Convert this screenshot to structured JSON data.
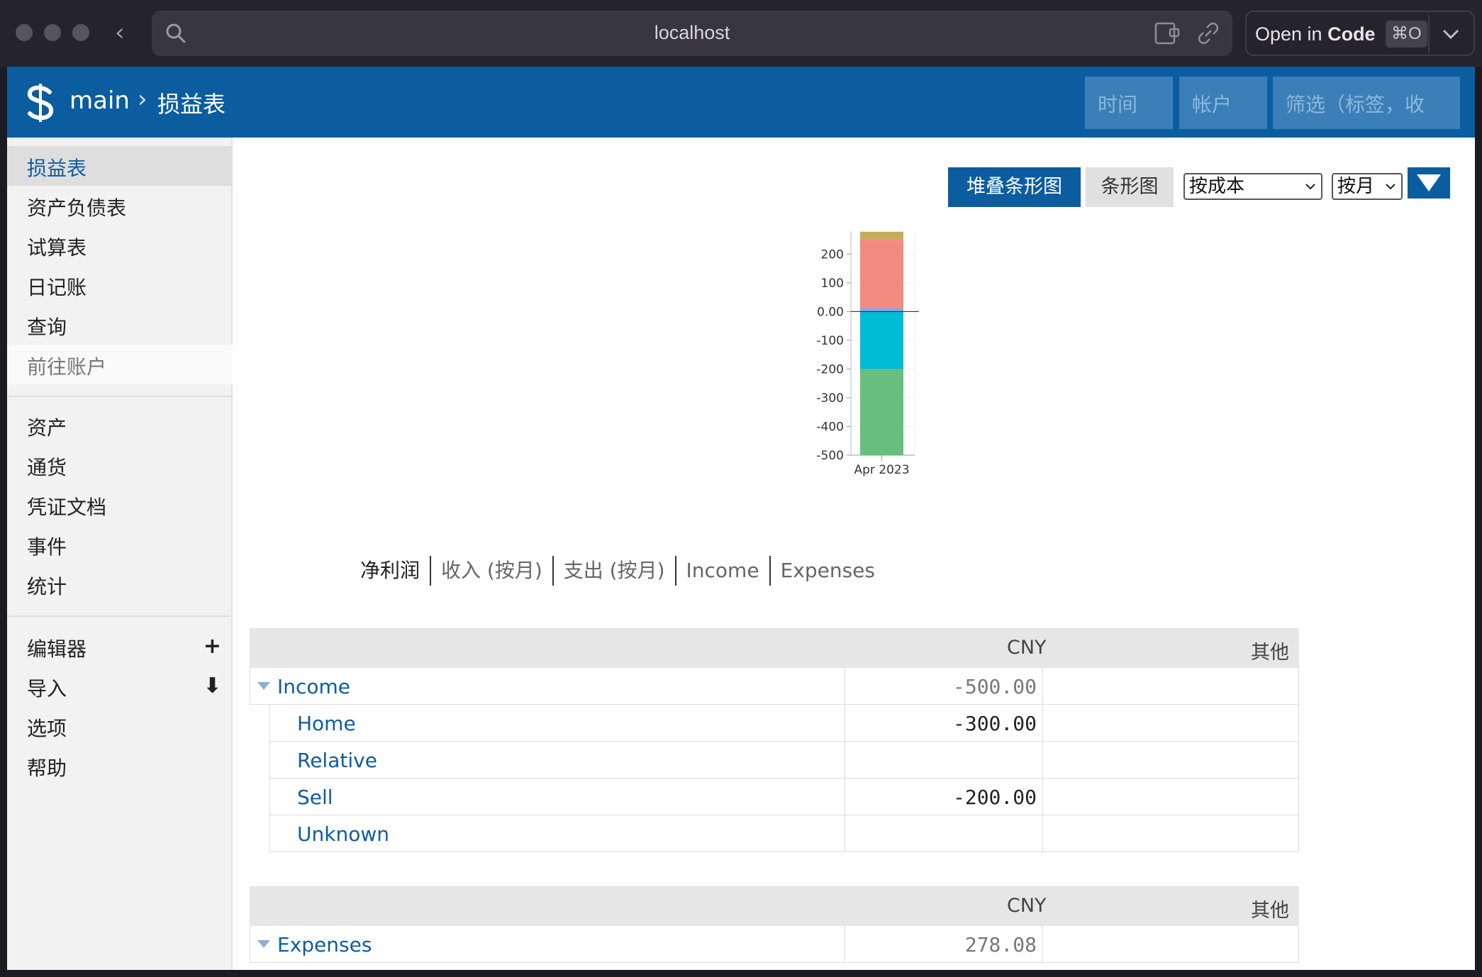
{
  "browser": {
    "url": "localhost",
    "open_in_label_prefix": "Open in ",
    "open_in_label_app": "Code",
    "open_in_shortcut": "⌘O"
  },
  "app": {
    "header": {
      "workspace": "main",
      "separator": "›",
      "page_title": "损益表",
      "time_placeholder": "时间",
      "account_placeholder": "帐户",
      "filter_placeholder": "筛选（标签，收"
    },
    "sidebar": {
      "primary": [
        {
          "label": "损益表",
          "state": "active"
        },
        {
          "label": "资产负债表"
        },
        {
          "label": "试算表"
        },
        {
          "label": "日记账"
        },
        {
          "label": "查询"
        },
        {
          "label": "前往账户",
          "state": "muted"
        }
      ],
      "secondary": [
        {
          "label": "资产"
        },
        {
          "label": "通货"
        },
        {
          "label": "凭证文档"
        },
        {
          "label": "事件"
        },
        {
          "label": "统计"
        }
      ],
      "tertiary": [
        {
          "label": "编辑器",
          "action": "+"
        },
        {
          "label": "导入",
          "action": "⬇"
        },
        {
          "label": "选项"
        },
        {
          "label": "帮助"
        }
      ]
    },
    "toolbar": {
      "stacked_bar_label": "堆叠条形图",
      "bar_label": "条形图",
      "conversion_value": "按成本",
      "interval_value": "按月"
    },
    "chart_tabs": [
      "净利润",
      "收入 (按月)",
      "支出 (按月)",
      "Income",
      "Expenses"
    ],
    "tables": [
      {
        "header": {
          "currency": "CNY",
          "other": "其他"
        },
        "root": {
          "name": "Income",
          "value": "-500.00"
        },
        "children": [
          {
            "name": "Home",
            "value": "-300.00"
          },
          {
            "name": "Relative",
            "value": ""
          },
          {
            "name": "Sell",
            "value": "-200.00"
          },
          {
            "name": "Unknown",
            "value": ""
          }
        ]
      },
      {
        "header": {
          "currency": "CNY",
          "other": "其他"
        },
        "root": {
          "name": "Expenses",
          "value": "278.08"
        },
        "children": []
      }
    ]
  },
  "chart_data": {
    "type": "bar",
    "stacked": true,
    "categories": [
      "Apr 2023"
    ],
    "yticks": [
      "200",
      "100",
      "0.00",
      "-100",
      "-200",
      "-300",
      "-400",
      "-500"
    ],
    "ylim": [
      -500,
      280
    ],
    "series": [
      {
        "color": "#00bcd4",
        "values": [
          -200
        ]
      },
      {
        "color": "#66bf7f",
        "values": [
          -300
        ]
      },
      {
        "color": "#8ea2e6",
        "values": [
          12
        ]
      },
      {
        "color": "#f28b82",
        "values": [
          238
        ]
      },
      {
        "color": "#c5ab5c",
        "values": [
          28
        ]
      }
    ]
  }
}
